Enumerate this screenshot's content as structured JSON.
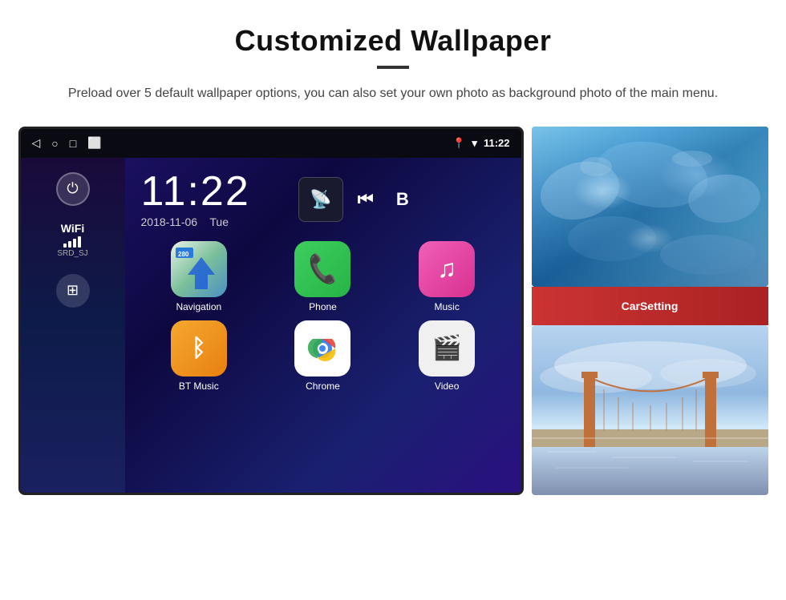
{
  "page": {
    "title": "Customized Wallpaper",
    "divider": true,
    "subtitle": "Preload over 5 default wallpaper options, you can also set your own photo as background photo of the main menu."
  },
  "device": {
    "status_bar": {
      "time": "11:22",
      "wifi_icon": "▾",
      "location_icon": "📍"
    },
    "sidebar": {
      "power_label": "⏻",
      "wifi_label": "WiFi",
      "signal_bars": 4,
      "ssid": "SRD_SJ",
      "grid_label": "⊞"
    },
    "clock": "11:22",
    "date": "2018-11-06",
    "day": "Tue",
    "apps": [
      {
        "id": "navigation",
        "label": "Navigation",
        "badge": "280"
      },
      {
        "id": "phone",
        "label": "Phone"
      },
      {
        "id": "music",
        "label": "Music"
      },
      {
        "id": "bt-music",
        "label": "BT Music"
      },
      {
        "id": "chrome",
        "label": "Chrome"
      },
      {
        "id": "video",
        "label": "Video"
      }
    ]
  },
  "wallpapers": [
    {
      "id": "ice",
      "alt": "Ice blue wallpaper"
    },
    {
      "id": "bridge",
      "alt": "Golden Gate Bridge wallpaper"
    }
  ],
  "carsetting": {
    "label": "CarSetting"
  }
}
